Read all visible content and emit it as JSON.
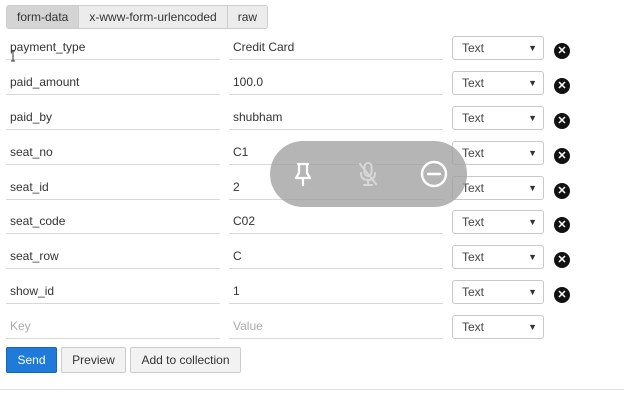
{
  "tabs": [
    {
      "label": "form-data",
      "active": true
    },
    {
      "label": "x-www-form-urlencoded",
      "active": false
    },
    {
      "label": "raw",
      "active": false
    }
  ],
  "rows": [
    {
      "key": "payment_type",
      "value": "Credit Card",
      "type": "Text"
    },
    {
      "key": "paid_amount",
      "value": "100.0",
      "type": "Text"
    },
    {
      "key": "paid_by",
      "value": "shubham",
      "type": "Text"
    },
    {
      "key": "seat_no",
      "value": "C1",
      "type": "Text"
    },
    {
      "key": "seat_id",
      "value": "2",
      "type": "Text"
    },
    {
      "key": "seat_code",
      "value": "C02",
      "type": "Text"
    },
    {
      "key": "seat_row",
      "value": "C",
      "type": "Text"
    },
    {
      "key": "show_id",
      "value": "1",
      "type": "Text"
    }
  ],
  "new_row": {
    "key_placeholder": "Key",
    "value_placeholder": "Value",
    "type": "Text"
  },
  "buttons": {
    "send": "Send",
    "preview": "Preview",
    "add_to_collection": "Add to collection"
  },
  "icons": {
    "delete": "close-circle-icon",
    "dropdown": "chevron-down-icon",
    "pin": "pin-icon",
    "mic_off": "mic-off-icon",
    "minimize": "minus-circle-icon"
  },
  "colors": {
    "send": "#1f7ad9",
    "overlay": "#a0a0a0"
  }
}
